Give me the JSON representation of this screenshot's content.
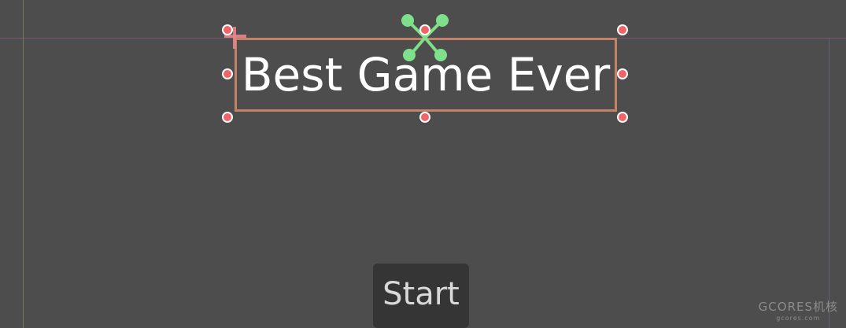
{
  "canvas": {
    "background_color": "#4d4d4d",
    "selection_color": "#c48366",
    "handle_color": "#f06467",
    "pivot_color": "#7ee08a"
  },
  "title_label": {
    "text": "Best Game Ever"
  },
  "start_button": {
    "label": "Start"
  },
  "watermark": {
    "main": "GCORES机核",
    "sub": "gcores.com"
  }
}
